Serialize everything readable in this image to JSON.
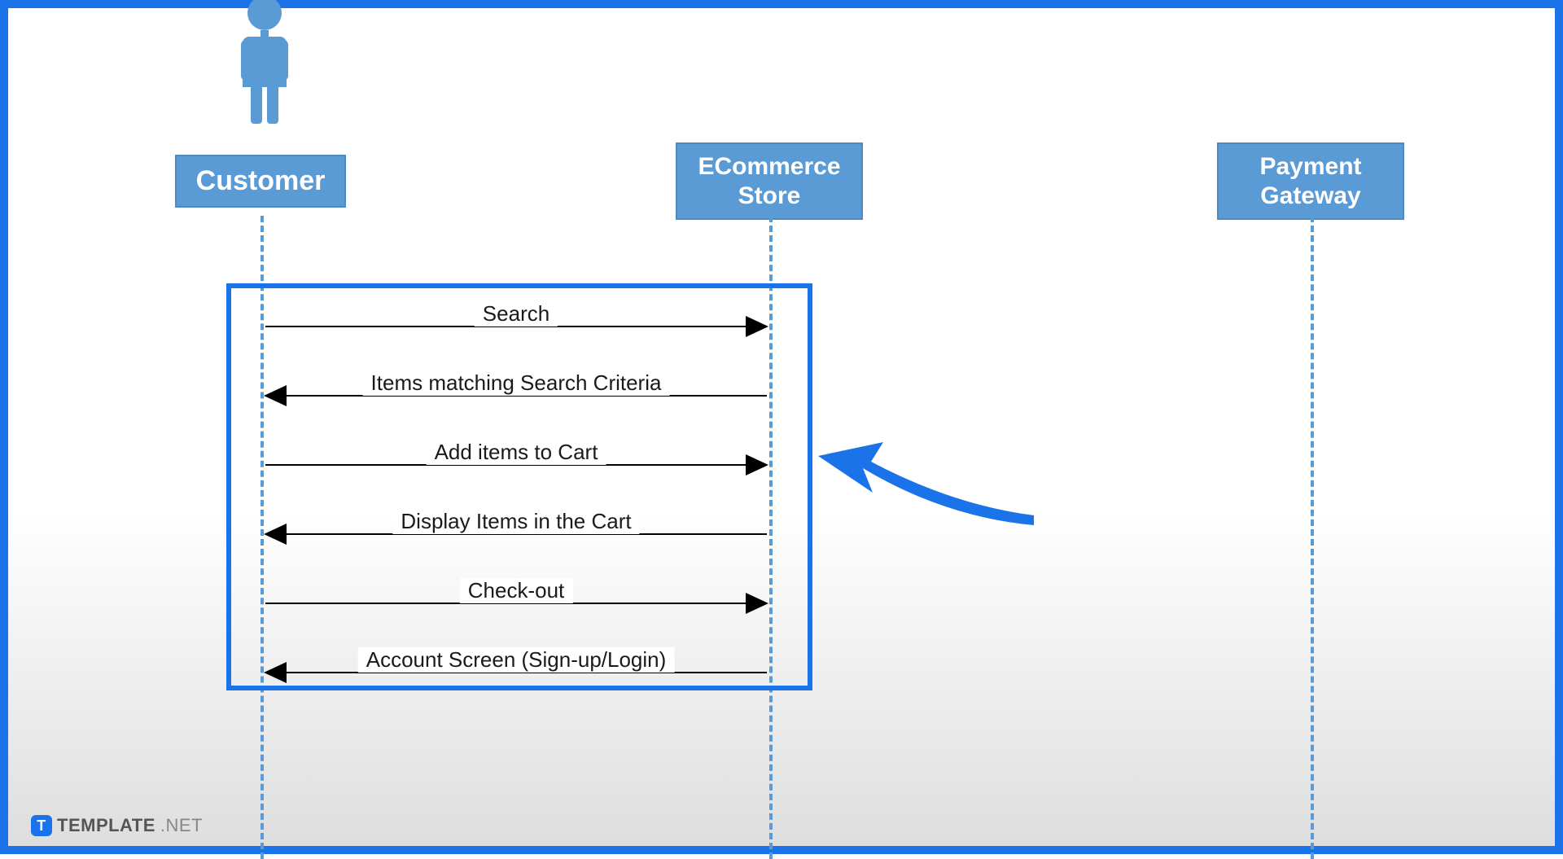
{
  "participants": {
    "customer": "Customer",
    "store_line1": "ECommerce",
    "store_line2": "Store",
    "gateway_line1": "Payment",
    "gateway_line2": "Gateway"
  },
  "messages": {
    "m1": "Search",
    "m2": "Items matching Search Criteria",
    "m3": "Add items to Cart",
    "m4": "Display Items in the Cart",
    "m5": "Check-out",
    "m6": "Account Screen (Sign-up/Login)"
  },
  "branding": {
    "badge": "T",
    "name": "TEMPLATE",
    "suffix": ".NET"
  },
  "colors": {
    "frame": "#1A73E8",
    "participant": "#5b9bd5"
  }
}
